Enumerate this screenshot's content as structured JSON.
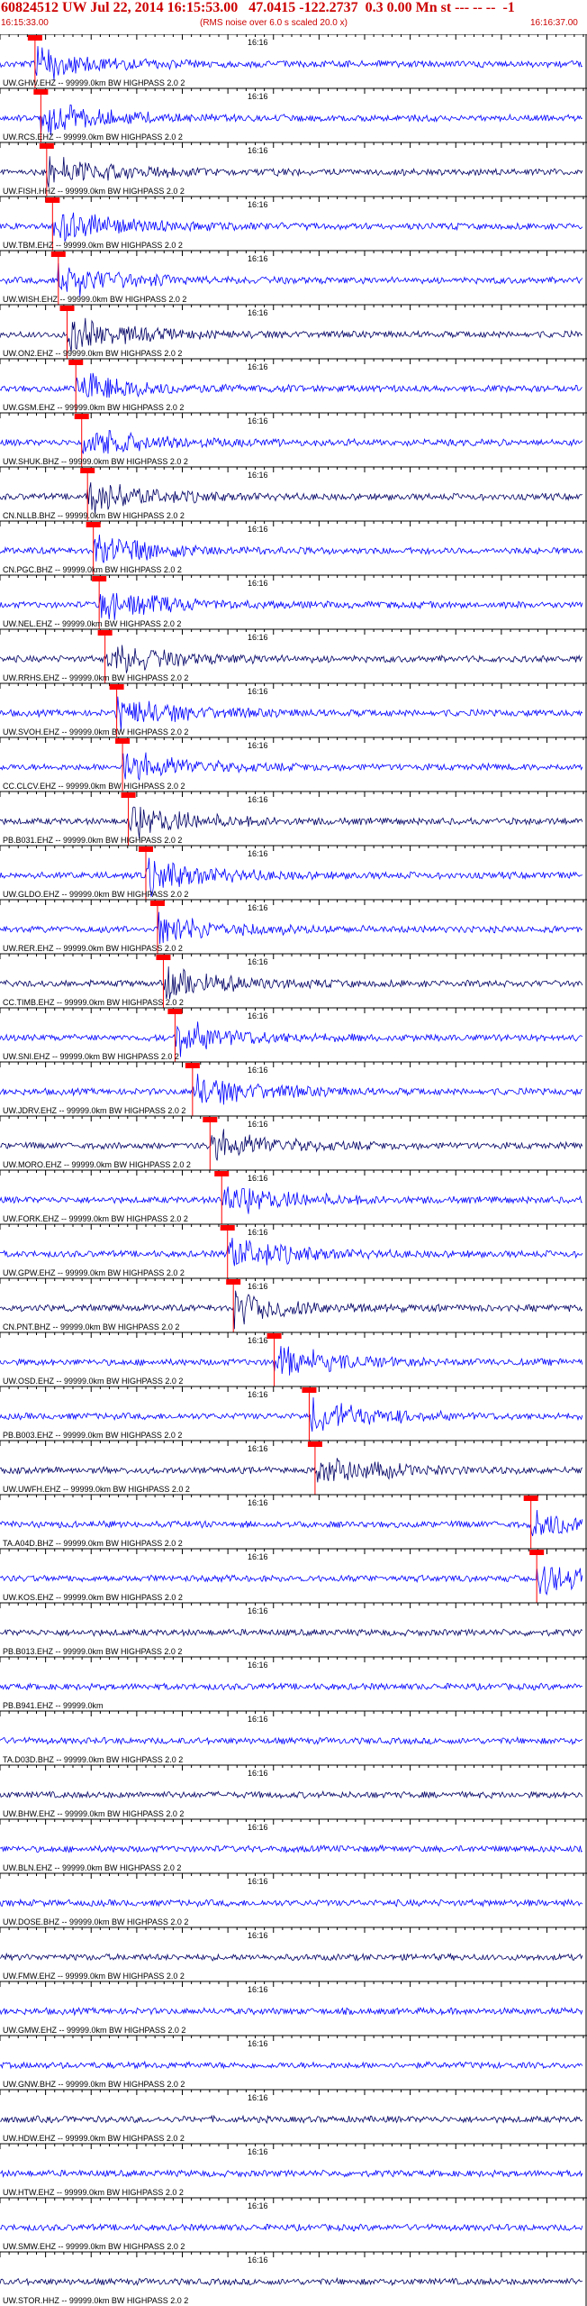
{
  "header": {
    "title": "60824512 UW Jul 22, 2014 16:15:53.00   47.0415 -122.2737  0.3 0.00 Mn st --- -- --  -1",
    "start_time": "16:15:33.00",
    "rms_note": "(RMS noise over 6.0 s scaled 20.0 x)",
    "end_time": "16:16:37.00"
  },
  "chart_data": {
    "type": "seismogram",
    "title": "60824512 UW Jul 22, 2014 16:15:53.00   47.0415 -122.2737  0.3 0.00 Mn st --- -- --  -1",
    "x_range": [
      "16:15:33.00",
      "16:16:37.00"
    ],
    "tick_label": "16:16",
    "colors": {
      "trace": "#0000ff",
      "trace_dark": "#000066",
      "pick": "#ff0000",
      "label": "#000000"
    },
    "traces": [
      {
        "label": "UW.GHW.EHZ -- 99999.0km BW  HIGHPASS  2.0  2",
        "pick": 0.06
      },
      {
        "label": "UW.RCS.EHZ -- 99999.0km BW  HIGHPASS  2.0  2",
        "pick": 0.07
      },
      {
        "label": "UW.FISH.HHZ -- 99999.0km BW  HIGHPASS  2.0  2",
        "pick": 0.08
      },
      {
        "label": "UW.TBM.EHZ -- 99999.0km BW  HIGHPASS  2.0  2",
        "pick": 0.09
      },
      {
        "label": "UW.WISH.EHZ -- 99999.0km BW  HIGHPASS  2.0  2",
        "pick": 0.1
      },
      {
        "label": "UW.ON2.EHZ -- 99999.0km BW  HIGHPASS  2.0  2",
        "pick": 0.115
      },
      {
        "label": "UW.GSM.EHZ -- 99999.0km BW  HIGHPASS  2.0  2",
        "pick": 0.13
      },
      {
        "label": "UW.SHUK.BHZ -- 99999.0km BW  HIGHPASS  2.0  2",
        "pick": 0.14
      },
      {
        "label": "CN.NLLB.BHZ -- 99999.0km BW  HIGHPASS  2.0  2",
        "pick": 0.15
      },
      {
        "label": "CN.PGC.BHZ -- 99999.0km BW  HIGHPASS  2.0  2",
        "pick": 0.16
      },
      {
        "label": "UW.NEL.EHZ -- 99999.0km BW  HIGHPASS  2.0  2",
        "pick": 0.17
      },
      {
        "label": "UW.RRHS.EHZ -- 99999.0km BW  HIGHPASS  2.0  2",
        "pick": 0.18
      },
      {
        "label": "UW.SVOH.EHZ -- 99999.0km BW  HIGHPASS  2.0  2",
        "pick": 0.2
      },
      {
        "label": "CC.CLCV.EHZ -- 99999.0km BW  HIGHPASS  2.0  2",
        "pick": 0.21
      },
      {
        "label": "PB.B031.EHZ -- 99999.0km BW  HIGHPASS  2.0  2",
        "pick": 0.22
      },
      {
        "label": "UW.GLDO.EHZ -- 99999.0km BW  HIGHPASS  2.0  2",
        "pick": 0.25
      },
      {
        "label": "UW.RER.EHZ -- 99999.0km BW  HIGHPASS  2.0  2",
        "pick": 0.27
      },
      {
        "label": "CC.TIMB.EHZ -- 99999.0km BW  HIGHPASS  2.0  2",
        "pick": 0.28
      },
      {
        "label": "UW.SNI.EHZ -- 99999.0km BW  HIGHPASS  2.0  2",
        "pick": 0.3
      },
      {
        "label": "UW.JDRV.EHZ -- 99999.0km BW  HIGHPASS  2.0  2",
        "pick": 0.33
      },
      {
        "label": "UW.MORO.EHZ -- 99999.0km BW  HIGHPASS  2.0  2",
        "pick": 0.36
      },
      {
        "label": "UW.FORK.EHZ -- 99999.0km BW  HIGHPASS  2.0  2",
        "pick": 0.38
      },
      {
        "label": "UW.GPW.EHZ -- 99999.0km BW  HIGHPASS  2.0  2",
        "pick": 0.39
      },
      {
        "label": "CN.PNT.BHZ -- 99999.0km BW  HIGHPASS  2.0  2",
        "pick": 0.4
      },
      {
        "label": "UW.OSD.EHZ -- 99999.0km BW  HIGHPASS  2.0  2",
        "pick": 0.47
      },
      {
        "label": "PB.B003.EHZ -- 99999.0km BW  HIGHPASS  2.0  2",
        "pick": 0.53
      },
      {
        "label": "UW.UWFH.EHZ -- 99999.0km BW  HIGHPASS  2.0  2",
        "pick": 0.54
      },
      {
        "label": "TA.A04D.BHZ -- 99999.0km BW  HIGHPASS  2.0  2",
        "pick": 0.91
      },
      {
        "label": "UW.KOS.EHZ -- 99999.0km BW  HIGHPASS  2.0  2",
        "pick": 0.92
      },
      {
        "label": "PB.B013.EHZ -- 99999.0km BW  HIGHPASS  2.0  2"
      },
      {
        "label": "PB.B941.EHZ -- 99999.0km"
      },
      {
        "label": "TA.D03D.BHZ -- 99999.0km BW  HIGHPASS  2.0  2"
      },
      {
        "label": "UW.BHW.EHZ -- 99999.0km BW  HIGHPASS  2.0  2"
      },
      {
        "label": "UW.BLN.EHZ -- 99999.0km BW  HIGHPASS  2.0  2"
      },
      {
        "label": "UW.DOSE.BHZ -- 99999.0km BW  HIGHPASS  2.0  2"
      },
      {
        "label": "UW.FMW.EHZ -- 99999.0km BW  HIGHPASS  2.0  2"
      },
      {
        "label": "UW.GMW.EHZ -- 99999.0km BW  HIGHPASS  2.0  2"
      },
      {
        "label": "UW.GNW.BHZ -- 99999.0km BW  HIGHPASS  2.0  2"
      },
      {
        "label": "UW.HDW.EHZ -- 99999.0km BW  HIGHPASS  2.0  2"
      },
      {
        "label": "UW.HTW.EHZ -- 99999.0km BW  HIGHPASS  2.0  2"
      },
      {
        "label": "UW.SMW.EHZ -- 99999.0km BW  HIGHPASS  2.0  2"
      },
      {
        "label": "UW.STOR.HHZ -- 99999.0km BW  HIGHPASS  2.0  2"
      }
    ]
  }
}
